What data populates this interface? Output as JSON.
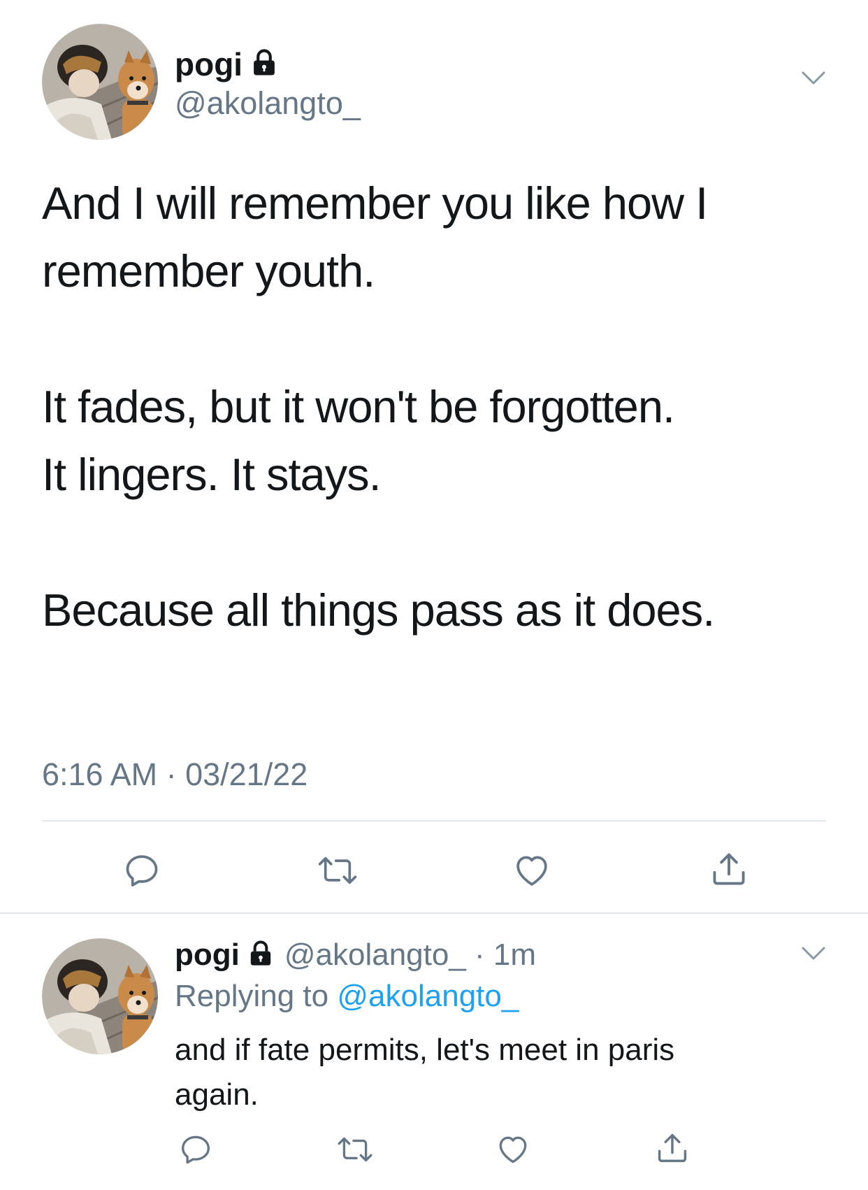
{
  "main_tweet": {
    "display_name": "pogi",
    "handle": "@akolangto_",
    "lines": [
      "And I will remember you like how I",
      "remember youth.",
      "It fades, but it won't be forgotten.",
      "It lingers. It stays.",
      "Because all things pass as it does."
    ],
    "timestamp": "6:16 AM · 03/21/22"
  },
  "reply_tweet": {
    "display_name": "pogi",
    "handle_time": "@akolangto_ · 1m",
    "replying_prefix": "Replying to",
    "replying_handle": "@akolangto_",
    "lines": [
      "and if fate permits, let's meet in paris",
      "again."
    ]
  },
  "icons": {
    "lock": "lock-icon",
    "chevron": "chevron-down-icon",
    "reply": "reply-icon",
    "retweet": "retweet-icon",
    "like": "like-icon",
    "share": "share-icon"
  },
  "colors": {
    "text": "#14171a",
    "secondary": "#657786",
    "link": "#1da1f2",
    "divider": "#e1e8ed"
  }
}
